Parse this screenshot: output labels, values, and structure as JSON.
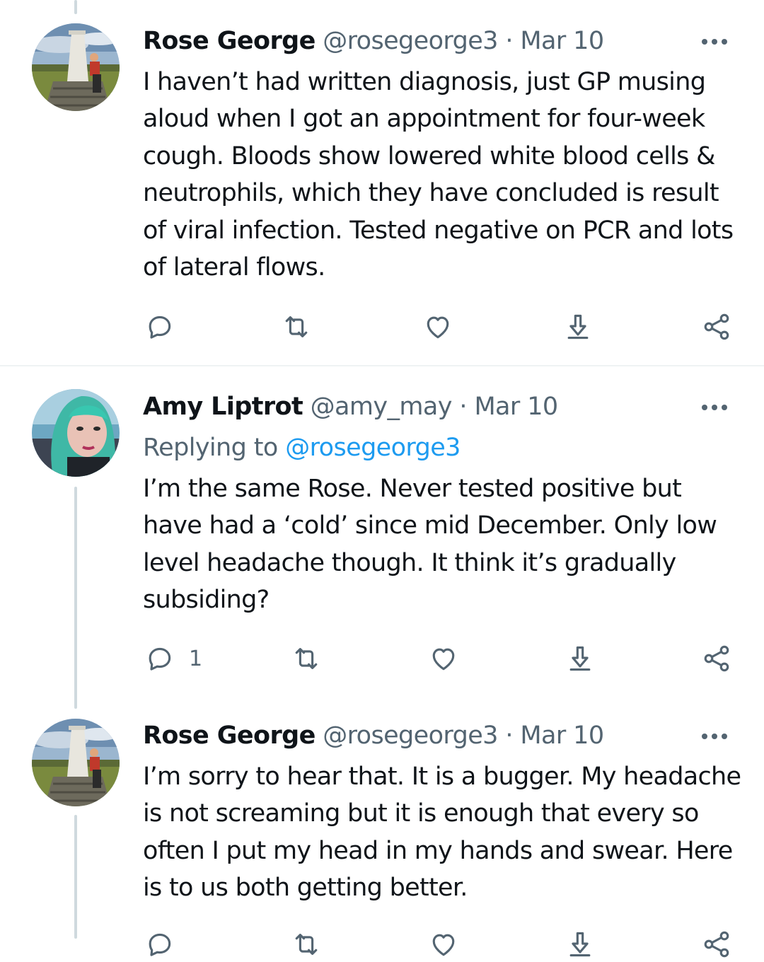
{
  "tweets": [
    {
      "name": "Rose George",
      "handle": "@rosegeorge3",
      "separator": "·",
      "date": "Mar 10",
      "body": "I haven’t had written diagnosis, just GP musing aloud when I got an appointment for four-week cough. Bloods show lowered white blood cells & neutrophils, which they have concluded is result of viral infection. Tested negative on PCR and lots of lateral flows.",
      "reply_count": ""
    },
    {
      "name": "Amy Liptrot",
      "handle": "@amy_may",
      "separator": "·",
      "date": "Mar 10",
      "replying_prefix": "Replying to",
      "replying_to": "@rosegeorge3",
      "body": "I’m the same Rose. Never tested positive but have had a ‘cold’ since mid December. Only low level headache though. It think it’s gradually subsiding?",
      "reply_count": "1"
    },
    {
      "name": "Rose George",
      "handle": "@rosegeorge3",
      "separator": "·",
      "date": "Mar 10",
      "body": "I’m sorry to hear that. It is a bugger. My headache is not screaming but it is enough that every so often I put my head in my hands and swear. Here is to us both getting better.",
      "reply_count": ""
    }
  ],
  "icons": {
    "reply": "reply-icon",
    "retweet": "retweet-icon",
    "like": "heart-icon",
    "share": "share-icon",
    "export": "export-icon",
    "more": "more-icon"
  },
  "colors": {
    "text": "#0f1419",
    "secondary": "#536471",
    "link": "#1d9bf0",
    "thread_line": "#cfd9de",
    "divider": "#eff3f4"
  }
}
